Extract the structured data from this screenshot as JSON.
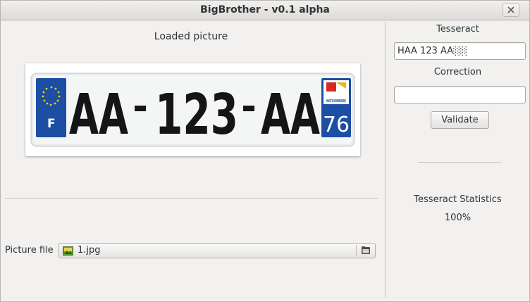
{
  "window": {
    "title": "BigBrother - v0.1 alpha"
  },
  "left": {
    "loaded_label": "Loaded picture",
    "plate": {
      "text_part1": "AA",
      "text_part2": "123",
      "text_part3": "AA",
      "country": "F",
      "dept_number": "76",
      "region_logo_text": "HAUTE NORMANDIE",
      "eu_band_color": "#1c4ea3"
    },
    "file_label": "Picture file",
    "file_name": "1.jpg"
  },
  "right": {
    "tesseract_label": "Tesseract",
    "tesseract_value": "HAA 123 AA░░",
    "correction_label": "Correction",
    "correction_value": "",
    "validate_label": "Validate",
    "stats_label": "Tesseract Statistics",
    "stats_value": "100%"
  }
}
